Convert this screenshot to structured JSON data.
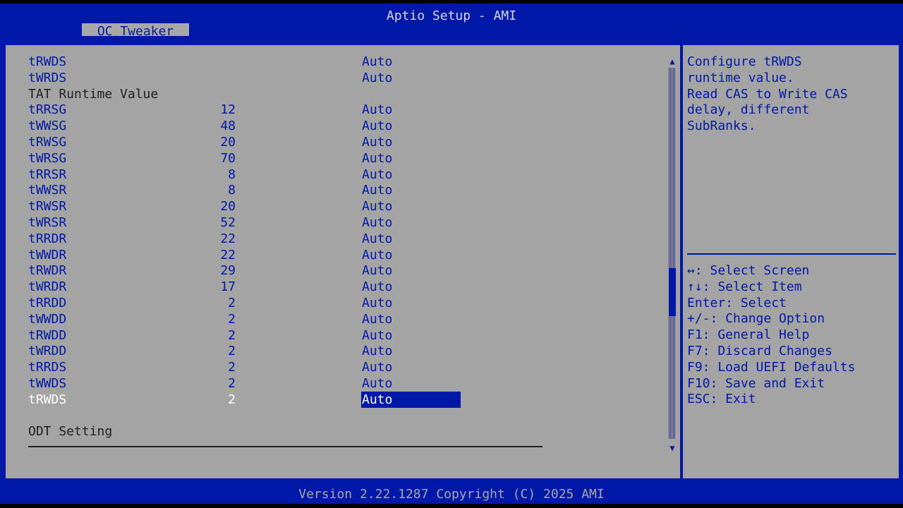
{
  "header": {
    "title": "Aptio Setup - AMI",
    "tab_label": "OC Tweaker"
  },
  "settings": [
    {
      "name": "tRWDS",
      "value": "",
      "option": "Auto"
    },
    {
      "name": "tWRDS",
      "value": "",
      "option": "Auto"
    },
    {
      "name": "TAT Runtime Value",
      "value": "",
      "option": "",
      "heading": true
    },
    {
      "name": "tRRSG",
      "value": "12",
      "option": "Auto"
    },
    {
      "name": "tWWSG",
      "value": "48",
      "option": "Auto"
    },
    {
      "name": "tRWSG",
      "value": "20",
      "option": "Auto"
    },
    {
      "name": "tWRSG",
      "value": "70",
      "option": "Auto"
    },
    {
      "name": "tRRSR",
      "value": "8",
      "option": "Auto"
    },
    {
      "name": "tWWSR",
      "value": "8",
      "option": "Auto"
    },
    {
      "name": "tRWSR",
      "value": "20",
      "option": "Auto"
    },
    {
      "name": "tWRSR",
      "value": "52",
      "option": "Auto"
    },
    {
      "name": "tRRDR",
      "value": "22",
      "option": "Auto"
    },
    {
      "name": "tWWDR",
      "value": "22",
      "option": "Auto"
    },
    {
      "name": "tRWDR",
      "value": "29",
      "option": "Auto"
    },
    {
      "name": "tWRDR",
      "value": "17",
      "option": "Auto"
    },
    {
      "name": "tRRDD",
      "value": "2",
      "option": "Auto"
    },
    {
      "name": "tWWDD",
      "value": "2",
      "option": "Auto"
    },
    {
      "name": "tRWDD",
      "value": "2",
      "option": "Auto"
    },
    {
      "name": "tWRDD",
      "value": "2",
      "option": "Auto"
    },
    {
      "name": "tRRDS",
      "value": "2",
      "option": "Auto"
    },
    {
      "name": "tWWDS",
      "value": "2",
      "option": "Auto"
    },
    {
      "name": "tRWDS",
      "value": "2",
      "option": "Auto",
      "selected": true
    }
  ],
  "section_heading": "ODT Setting",
  "scroll": {
    "up_glyph": "▲",
    "down_glyph": "▼",
    "position_fraction": 0.62,
    "visible_fraction": 0.13
  },
  "help": {
    "lines": [
      "Configure tRWDS",
      "runtime value.",
      "Read CAS to Write CAS",
      "delay, different",
      "SubRanks."
    ]
  },
  "keys": [
    "↔: Select Screen",
    "↑↓: Select Item",
    "Enter: Select",
    "+/-: Change Option",
    "F1: General Help",
    "F7: Discard Changes",
    "F9: Load UEFI Defaults",
    "F10: Save and Exit",
    "ESC: Exit"
  ],
  "footer": "Version 2.22.1287 Copyright (C) 2025 AMI",
  "colors": {
    "bios_blue": "#0018a8",
    "panel_gray": "#a4a4a4",
    "selected_text": "#ffffff"
  }
}
